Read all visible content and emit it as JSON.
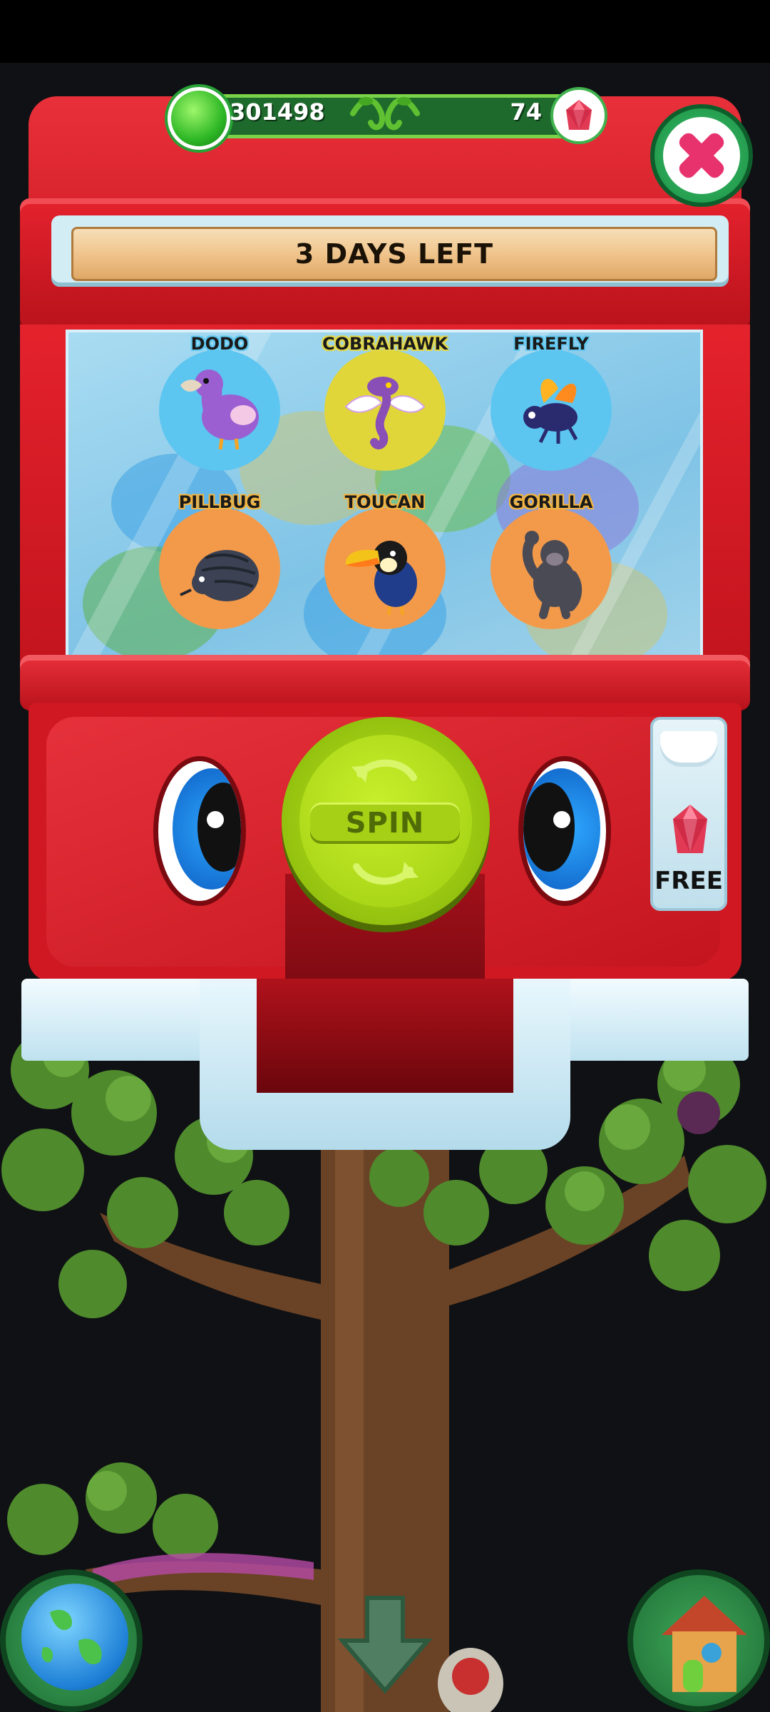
{
  "currency": {
    "coins": "301498",
    "gems": "74"
  },
  "banner": {
    "text": "3 DAYS LEFT"
  },
  "prizes": [
    {
      "name": "DODO",
      "bg": "#5cc6f0",
      "label_style": "blue"
    },
    {
      "name": "COBRAHAWK",
      "bg": "#e0d63a",
      "label_style": "yellow"
    },
    {
      "name": "FIREFLY",
      "bg": "#5cc6f0",
      "label_style": "blue"
    },
    {
      "name": "PILLBUG",
      "bg": "#f39a4a",
      "label_style": "orange"
    },
    {
      "name": "TOUCAN",
      "bg": "#f39a4a",
      "label_style": "orange"
    },
    {
      "name": "GORILLA",
      "bg": "#f39a4a",
      "label_style": "orange"
    }
  ],
  "spin_button": {
    "label": "SPIN"
  },
  "free_button": {
    "label": "FREE"
  },
  "icons": {
    "close": "close-x-icon",
    "globe": "globe-icon",
    "home": "treehouse-icon",
    "down": "down-arrow-icon"
  },
  "colors": {
    "machine_red": "#d81f29",
    "spin_green": "#a6d015",
    "close_pink": "#e8326e"
  }
}
